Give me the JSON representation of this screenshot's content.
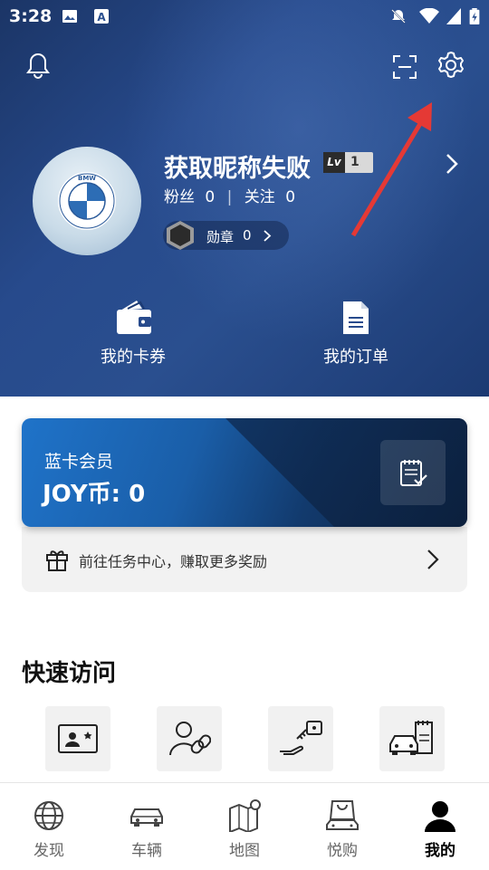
{
  "status": {
    "time": "3:28"
  },
  "profile": {
    "nickname": "获取昵称失败",
    "level_tag": "Lv",
    "level": "1",
    "fans_label": "粉丝",
    "fans_count": "0",
    "follow_label": "关注",
    "follow_count": "0",
    "medal_label": "勋章",
    "medal_count": "0",
    "brand_logo": "BMW"
  },
  "quick_links": [
    {
      "label": "我的卡券",
      "icon": "wallet-icon"
    },
    {
      "label": "我的订单",
      "icon": "document-icon"
    }
  ],
  "membership": {
    "title": "蓝卡会员",
    "coins": "JOY币: 0",
    "task_text": "前往任务中心，赚取更多奖励"
  },
  "quick_access": {
    "title": "快速访问",
    "items": [
      "id-card-icon",
      "user-link-icon",
      "car-key-hand-icon",
      "car-service-icon"
    ]
  },
  "tabs": [
    {
      "label": "发现",
      "icon": "globe-icon",
      "active": false
    },
    {
      "label": "车辆",
      "icon": "car-icon",
      "active": false
    },
    {
      "label": "地图",
      "icon": "map-icon",
      "active": false
    },
    {
      "label": "悦购",
      "icon": "shopping-bag-icon",
      "active": false
    },
    {
      "label": "我的",
      "icon": "person-icon",
      "active": true
    }
  ],
  "colors": {
    "hero": "#274a8c",
    "card_blue": "#1f73c9",
    "annotation_arrow": "#e53935"
  }
}
